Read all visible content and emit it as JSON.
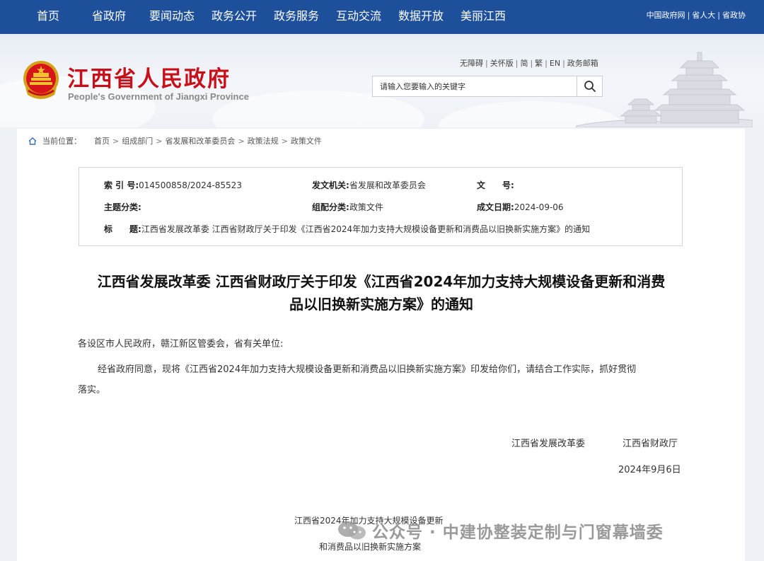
{
  "topnav": {
    "items": [
      "首页",
      "省政府",
      "要闻动态",
      "政务公开",
      "政务服务",
      "互动交流",
      "数据开放",
      "美丽江西"
    ],
    "right_links": [
      "中国政府网",
      "省人大",
      "省政协"
    ]
  },
  "header": {
    "title": "江西省人民政府",
    "subtitle": "People's Government of Jiangxi Province",
    "access_links": [
      "无障碍",
      "关怀版",
      "简",
      "繁",
      "EN",
      "政务邮箱"
    ],
    "search_placeholder": "请输入您要输入的关键字"
  },
  "breadcrumb": {
    "label": "当前位置：",
    "items": [
      "首页",
      "组成部门",
      "省发展和改革委员会",
      "政策法规",
      "政策文件"
    ]
  },
  "meta": {
    "index_label": "索 引 号:",
    "index_value": "014500858/2024-85523",
    "issuer_label": "发文机关:",
    "issuer_value": "省发展和改革委员会",
    "docno_label": "文　　号:",
    "docno_value": "",
    "topic_label": "主题分类:",
    "topic_value": "",
    "category_label": "组配分类:",
    "category_value": "政策文件",
    "date_label": "成文日期:",
    "date_value": "2024-09-06",
    "title_label": "标　　题:",
    "title_value": "江西省发展改革委 江西省财政厅关于印发《江西省2024年加力支持大规模设备更新和消费品以旧换新实施方案》的通知"
  },
  "document": {
    "title_line1": "江西省发展改革委 江西省财政厅关于印发《江西省2024年加力支持大规模设备更新和消费",
    "title_line2": "品以旧换新实施方案》的通知",
    "salutation": "各设区市人民政府，赣江新区管委会，省有关单位:",
    "body_line1": "经省政府同意，现将《江西省2024年加力支持大规模设备更新和消费品以旧换新实施方案》印发给你们，请结合工作实际，抓好贯彻",
    "body_line2": "落实。",
    "signer1": "江西省发展改革委",
    "signer2": "江西省财政厅",
    "sign_date": "2024年9月6日",
    "attachment_line1": "江西省2024年加力支持大规模设备更新",
    "attachment_line2": "和消费品以旧换新实施方案"
  },
  "watermark": {
    "text": "公众号 · 中建协整装定制与门窗幕墙委"
  },
  "colors": {
    "nav_bg": "#1d4f9a",
    "title_red": "#c8101a"
  }
}
